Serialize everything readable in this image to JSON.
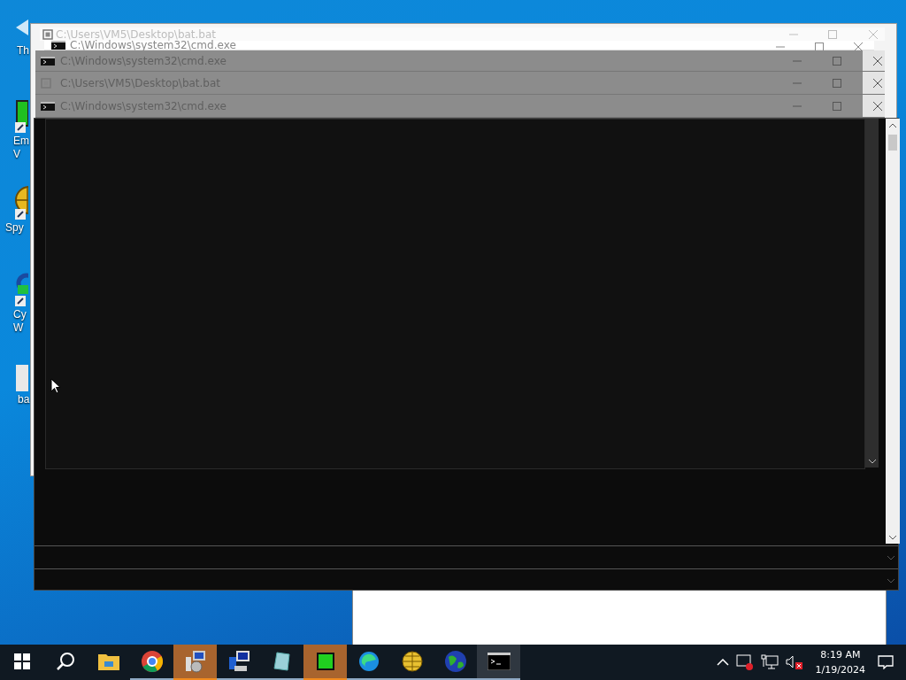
{
  "desktop_icons": [
    {
      "kind": "arrow",
      "label_lines": [
        "Th"
      ]
    },
    {
      "kind": "chip",
      "label_lines": [
        "Em",
        "V"
      ]
    },
    {
      "kind": "radar",
      "label_lines": [
        "Spy"
      ]
    },
    {
      "kind": "cycle",
      "label_lines": [
        "Cy",
        "W"
      ]
    },
    {
      "kind": "file",
      "label_lines": [
        "ba"
      ]
    }
  ],
  "windows": [
    {
      "title": "C:\\Users\\VM5\\Desktop\\bat.bat",
      "kind": "bat"
    },
    {
      "title": "C:\\Windows\\system32\\cmd.exe",
      "kind": "cmd"
    },
    {
      "title": "C:\\Windows\\system32\\cmd.exe",
      "kind": "cmd"
    },
    {
      "title": "C:\\Users\\VM5\\Desktop\\bat.bat",
      "kind": "bat"
    },
    {
      "title": "C:\\Windows\\system32\\cmd.exe",
      "kind": "cmd"
    }
  ],
  "taskbar": {
    "items": [
      {
        "kind": "start",
        "running": false,
        "flashing": false,
        "selected": false
      },
      {
        "kind": "search",
        "running": false,
        "flashing": false,
        "selected": false
      },
      {
        "kind": "folder",
        "running": false,
        "flashing": false,
        "selected": false
      },
      {
        "kind": "browser",
        "running": true,
        "flashing": false,
        "selected": false
      },
      {
        "kind": "installer",
        "running": true,
        "flashing": true,
        "selected": false
      },
      {
        "kind": "network",
        "running": true,
        "flashing": false,
        "selected": false
      },
      {
        "kind": "glass",
        "running": true,
        "flashing": false,
        "selected": false
      },
      {
        "kind": "chip",
        "running": true,
        "flashing": true,
        "selected": false
      },
      {
        "kind": "swirl",
        "running": true,
        "flashing": false,
        "selected": false
      },
      {
        "kind": "radar",
        "running": true,
        "flashing": false,
        "selected": false
      },
      {
        "kind": "globe",
        "running": true,
        "flashing": false,
        "selected": false
      },
      {
        "kind": "console",
        "running": true,
        "flashing": false,
        "selected": true
      }
    ],
    "time": "8:19 AM",
    "date": "1/19/2024"
  }
}
